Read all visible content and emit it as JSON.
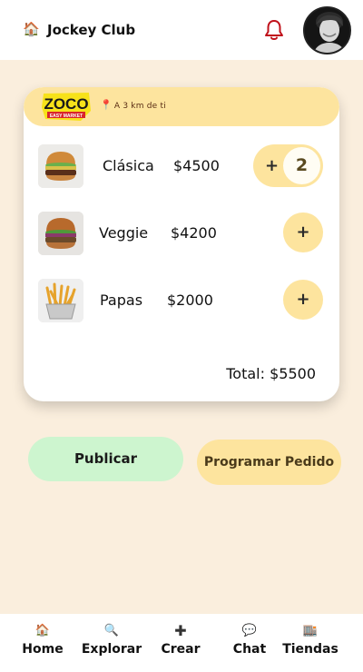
{
  "header": {
    "title": "Jockey Club",
    "home_icon": "house-icon",
    "notification_icon": "bell-icon"
  },
  "store": {
    "logo_text": "ZOCO",
    "logo_subtext": "EASY MARKET",
    "distance": "A 3 km de ti"
  },
  "items": [
    {
      "name": "Clásica",
      "price": "$4500",
      "quantity": "2",
      "add_label": "+"
    },
    {
      "name": "Veggie",
      "price": "$4200",
      "add_label": "+"
    },
    {
      "name": "Papas",
      "price": "$2000",
      "add_label": "+"
    }
  ],
  "total": "Total: $5500",
  "actions": {
    "publish": "Publicar",
    "schedule": "Programar Pedido"
  },
  "nav": [
    {
      "label": "Home",
      "icon": "house-icon",
      "glyph": "🏠"
    },
    {
      "label": "Explorar",
      "icon": "magnifier-icon",
      "glyph": "🔍"
    },
    {
      "label": "Crear",
      "icon": "plus-icon",
      "glyph": "✚"
    },
    {
      "label": "Chat",
      "icon": "speech-bubble-icon",
      "glyph": "💬"
    },
    {
      "label": "Tiendas",
      "icon": "building-icon",
      "glyph": "🏬"
    }
  ],
  "colors": {
    "background": "#faeedd",
    "accent_yellow": "#fde49e",
    "publish_green": "#cdf5cf",
    "bell_red": "#c0121b"
  }
}
